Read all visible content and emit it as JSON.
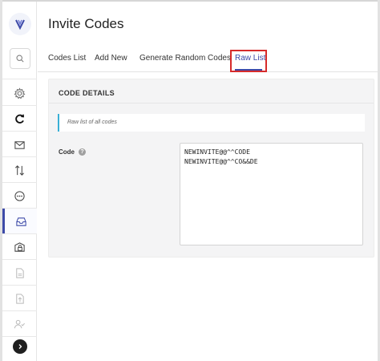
{
  "header": {
    "title": "Invite Codes"
  },
  "tabs": [
    {
      "label": "Codes List"
    },
    {
      "label": "Add New"
    },
    {
      "label": "Generate Random Codes"
    },
    {
      "label": "Raw List"
    }
  ],
  "active_tab": "Raw List",
  "card": {
    "title": "CODE DETAILS",
    "info": "Raw list of all codes",
    "code_label": "Code",
    "codes_text": "NEWINVITE@@^^CODE\nNEWINVITE@@^^CO&&DE"
  },
  "sidebar": {
    "items": [
      {
        "icon": "gear-icon"
      },
      {
        "icon": "refresh-icon"
      },
      {
        "icon": "mail-icon"
      },
      {
        "icon": "sort-arrows-icon"
      },
      {
        "icon": "more-circle-icon"
      },
      {
        "icon": "inbox-icon"
      },
      {
        "icon": "mail-lock-icon"
      },
      {
        "icon": "document-icon"
      },
      {
        "icon": "upload-icon"
      },
      {
        "icon": "user-check-icon"
      }
    ]
  },
  "colors": {
    "accent": "#3d4aa8",
    "highlight": "#d62b2b",
    "info_border": "#3ab0d6"
  }
}
